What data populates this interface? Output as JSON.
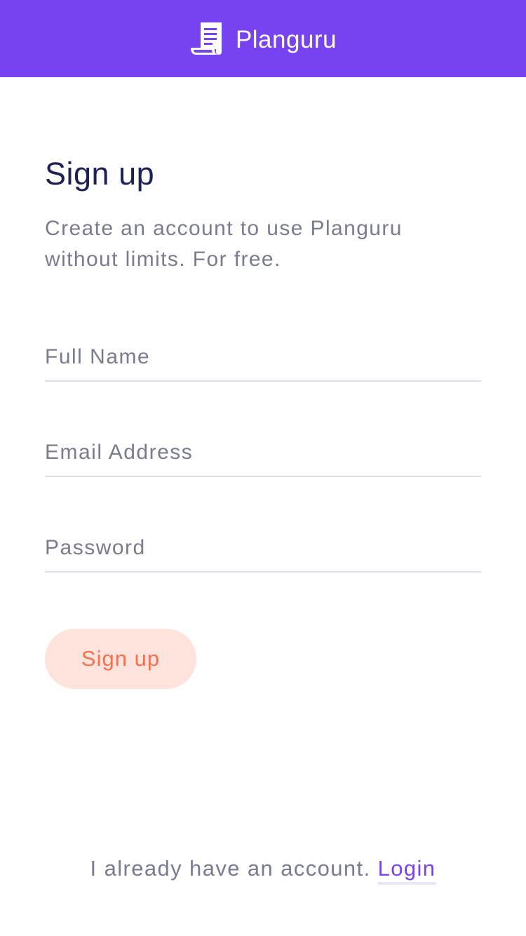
{
  "header": {
    "app_name": "Planguru",
    "icon": "document-scroll-icon",
    "background_color": "#7743f0"
  },
  "main": {
    "title": "Sign up",
    "subtitle": "Create an account to use Planguru without limits. For free."
  },
  "form": {
    "full_name": {
      "placeholder": "Full Name",
      "value": ""
    },
    "email": {
      "placeholder": "Email Address",
      "value": ""
    },
    "password": {
      "placeholder": "Password",
      "value": ""
    },
    "submit_label": "Sign up",
    "submit_bg_color": "#ffe3dc",
    "submit_text_color": "#f7714d"
  },
  "footer": {
    "prompt": "I already have an account.",
    "login_label": "Login",
    "link_color": "#7743f0"
  }
}
